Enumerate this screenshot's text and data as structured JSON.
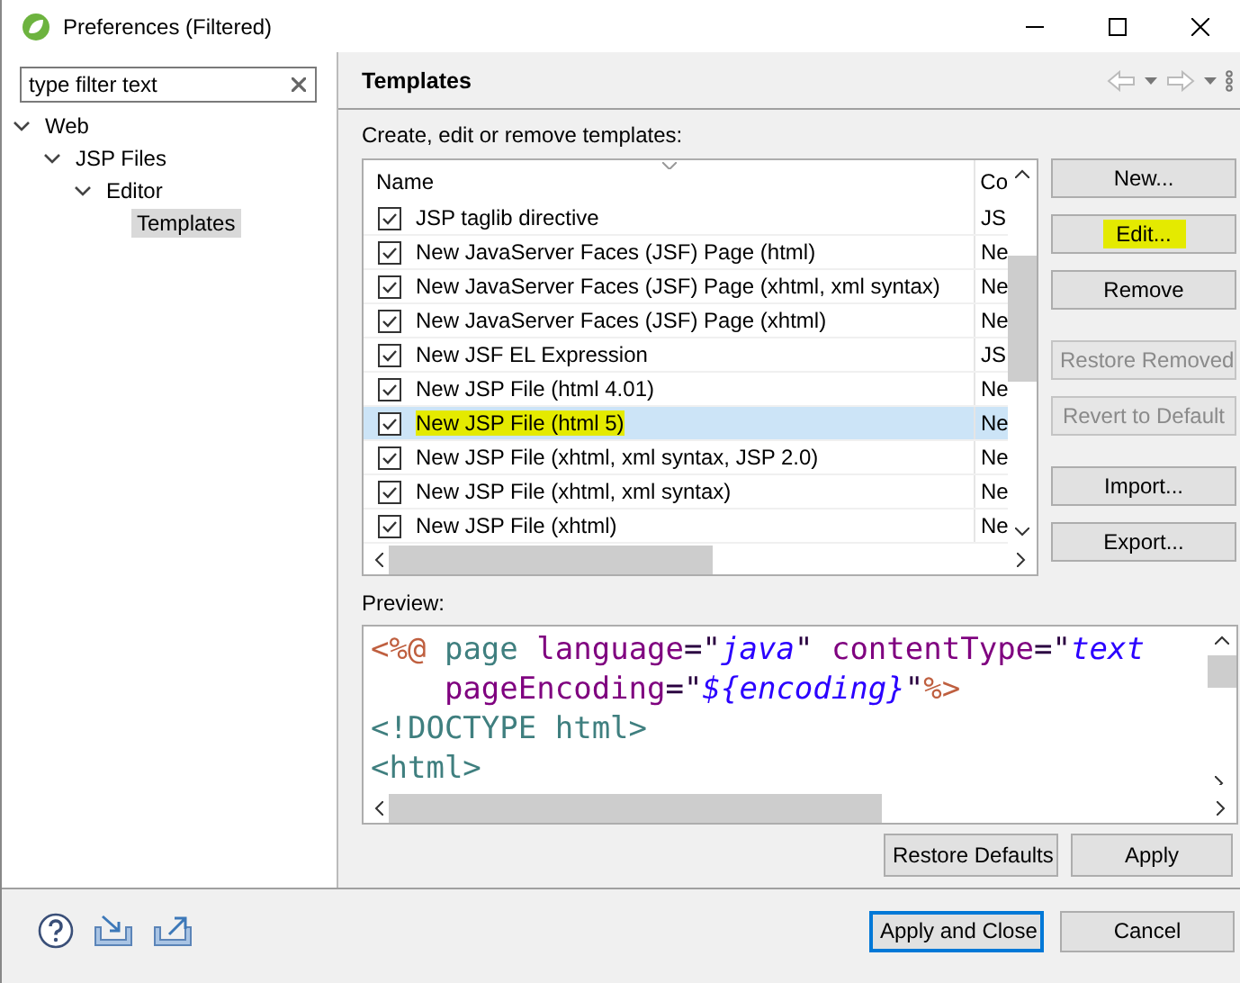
{
  "window": {
    "title": "Preferences (Filtered)"
  },
  "filter": {
    "placeholder": "type filter text"
  },
  "tree": [
    {
      "label": "Web",
      "expanded": true,
      "selected": false,
      "children": [
        {
          "label": "JSP Files",
          "expanded": true,
          "selected": false,
          "children": [
            {
              "label": "Editor",
              "expanded": true,
              "selected": false,
              "children": [
                {
                  "label": "Templates",
                  "selected": true
                }
              ]
            }
          ]
        }
      ]
    }
  ],
  "page": {
    "title": "Templates",
    "description": "Create, edit or remove templates:"
  },
  "table": {
    "columns": [
      "Name",
      "Co"
    ],
    "rows": [
      {
        "name": "JSP taglib directive",
        "column_2": "JS",
        "checked": true,
        "selected": false,
        "highlighted": false
      },
      {
        "name": "New JavaServer Faces (JSF) Page (html)",
        "column_2": "Ne",
        "checked": true,
        "selected": false,
        "highlighted": false
      },
      {
        "name": "New JavaServer Faces (JSF) Page (xhtml, xml syntax)",
        "column_2": "Ne",
        "checked": true,
        "selected": false,
        "highlighted": false
      },
      {
        "name": "New JavaServer Faces (JSF) Page (xhtml)",
        "column_2": "Ne",
        "checked": true,
        "selected": false,
        "highlighted": false
      },
      {
        "name": "New JSF EL Expression",
        "column_2": "JS",
        "checked": true,
        "selected": false,
        "highlighted": false
      },
      {
        "name": "New JSP File (html 4.01)",
        "column_2": "Ne",
        "checked": true,
        "selected": false,
        "highlighted": false
      },
      {
        "name": "New JSP File (html 5)",
        "column_2": "Ne",
        "checked": true,
        "selected": true,
        "highlighted": true
      },
      {
        "name": "New JSP File (xhtml, xml syntax, JSP 2.0)",
        "column_2": "Ne",
        "checked": true,
        "selected": false,
        "highlighted": false
      },
      {
        "name": "New JSP File (xhtml, xml syntax)",
        "column_2": "Ne",
        "checked": true,
        "selected": false,
        "highlighted": false
      },
      {
        "name": "New JSP File (xhtml)",
        "column_2": "Ne",
        "checked": true,
        "selected": false,
        "highlighted": false
      }
    ]
  },
  "side_button_groups": [
    [
      {
        "label": "New...",
        "disabled": false,
        "highlighted": false
      },
      {
        "label": "Edit...",
        "disabled": false,
        "highlighted": true
      },
      {
        "label": "Remove",
        "disabled": false,
        "highlighted": false
      }
    ],
    [
      {
        "label": "Restore Removed",
        "disabled": true,
        "highlighted": false
      },
      {
        "label": "Revert to Default",
        "disabled": true,
        "highlighted": false
      }
    ],
    [
      {
        "label": "Import...",
        "disabled": false,
        "highlighted": false
      },
      {
        "label": "Export...",
        "disabled": false,
        "highlighted": false
      }
    ]
  ],
  "preview": {
    "label": "Preview:",
    "lines": [
      [
        {
          "kind": "delim",
          "text": "<%@"
        },
        {
          "kind": "tag",
          "text": " page"
        },
        {
          "kind": "attr",
          "text": " language"
        },
        {
          "kind": "plain",
          "text": "=\""
        },
        {
          "kind": "value",
          "text": "java"
        },
        {
          "kind": "plain",
          "text": "\" "
        },
        {
          "kind": "attr",
          "text": "contentType"
        },
        {
          "kind": "plain",
          "text": "=\""
        },
        {
          "kind": "value",
          "text": "text"
        }
      ],
      [
        {
          "kind": "attr",
          "text": "    pageEncoding"
        },
        {
          "kind": "plain",
          "text": "=\""
        },
        {
          "kind": "value",
          "text": "${encoding}"
        },
        {
          "kind": "plain",
          "text": "\""
        },
        {
          "kind": "delim",
          "text": "%>"
        }
      ],
      [
        {
          "kind": "tag",
          "text": "<!DOCTYPE html>"
        }
      ],
      [
        {
          "kind": "tag",
          "text": "<html>"
        }
      ]
    ]
  },
  "page_buttons": [
    "Restore Defaults",
    "Apply"
  ],
  "dialog_buttons": [
    {
      "label": "Apply and Close",
      "default": true
    },
    {
      "label": "Cancel",
      "default": false
    }
  ]
}
